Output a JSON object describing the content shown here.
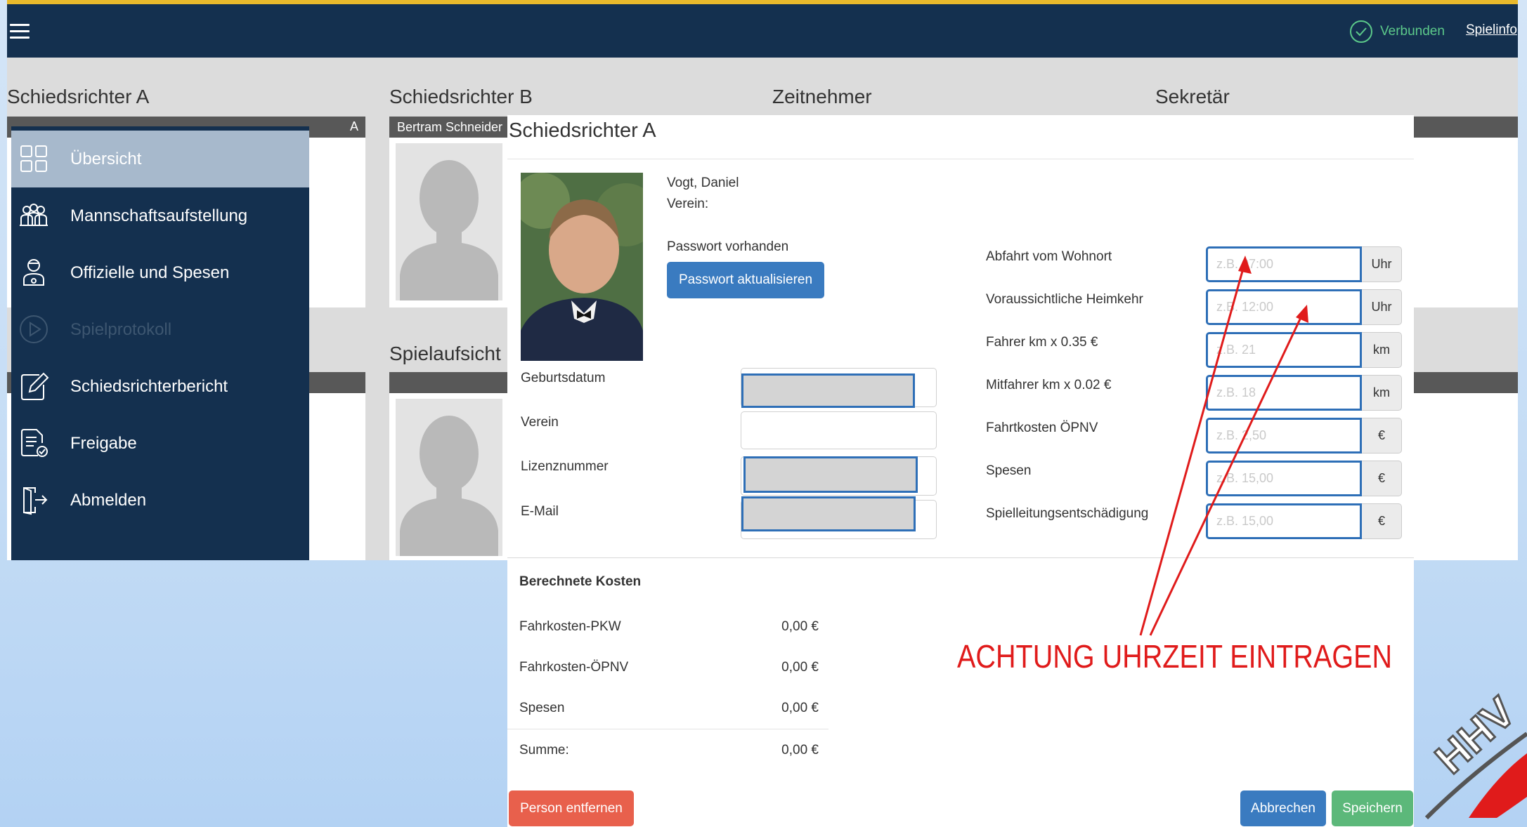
{
  "topbar": {
    "status_label": "Verbunden",
    "status_color": "#5cc98a",
    "spielinfo_link": "Spielinfo",
    "menu_icon": "hamburger-icon",
    "accent_color": "#e8b92c",
    "bar_color": "#14304f"
  },
  "background": {
    "sections": {
      "schiedsrichter_a": "Schiedsrichter A",
      "schiedsrichter_b": "Schiedsrichter B",
      "zeitnehmer": "Zeitnehmer",
      "sekretaer": "Sekretär",
      "spielaufsicht": "Spielaufsicht"
    },
    "card_a_badge": "A",
    "card_b_name": "Bertram Schneider"
  },
  "sidebar": {
    "items": [
      {
        "label": "Übersicht",
        "icon": "grid-icon",
        "state": "active"
      },
      {
        "label": "Mannschaftsaufstellung",
        "icon": "team-icon",
        "state": "normal"
      },
      {
        "label": "Offizielle und Spesen",
        "icon": "official-icon",
        "state": "normal"
      },
      {
        "label": "Spielprotokoll",
        "icon": "play-circle-icon",
        "state": "disabled"
      },
      {
        "label": "Schiedsrichterbericht",
        "icon": "edit-report-icon",
        "state": "normal"
      },
      {
        "label": "Freigabe",
        "icon": "document-check-icon",
        "state": "normal"
      },
      {
        "label": "Abmelden",
        "icon": "logout-icon",
        "state": "normal"
      }
    ]
  },
  "modal": {
    "title": "Schiedsrichter A",
    "person_name": "Vogt, Daniel",
    "verein_label": "Verein:",
    "password_status": "Passwort vorhanden",
    "password_button": "Passwort aktualisieren",
    "fields": {
      "geburtsdatum": "Geburtsdatum",
      "verein": "Verein",
      "lizenznummer": "Lizenznummer",
      "email": "E-Mail"
    },
    "expenses": [
      {
        "label": "Abfahrt vom Wohnort",
        "placeholder": "z.B. 07:00",
        "unit": "Uhr"
      },
      {
        "label": "Voraussichtliche Heimkehr",
        "placeholder": "z.B. 12:00",
        "unit": "Uhr"
      },
      {
        "label": "Fahrer km x 0.35 €",
        "placeholder": "z.B. 21",
        "unit": "km"
      },
      {
        "label": "Mitfahrer km x 0.02 €",
        "placeholder": "z.B. 18",
        "unit": "km"
      },
      {
        "label": "Fahrtkosten ÖPNV",
        "placeholder": "z.B. 2,50",
        "unit": "€"
      },
      {
        "label": "Spesen",
        "placeholder": "z.B. 15,00",
        "unit": "€"
      },
      {
        "label": "Spielleitungsentschädigung",
        "placeholder": "z.B. 15,00",
        "unit": "€"
      }
    ],
    "costs_heading": "Berechnete Kosten",
    "costs": [
      {
        "label": "Fahrkosten-PKW",
        "value": "0,00 €"
      },
      {
        "label": "Fahrkosten-ÖPNV",
        "value": "0,00 €"
      },
      {
        "label": "Spesen",
        "value": "0,00 €"
      }
    ],
    "sum": {
      "label": "Summe:",
      "value": "0,00 €"
    },
    "remove_button": "Person entfernen",
    "cancel_button": "Abbrechen",
    "save_button": "Speichern",
    "remove_color": "#e8604c",
    "cancel_color": "#3a7bc0",
    "save_color": "#5cb87a"
  },
  "annotation": {
    "text": "ACHTUNG UHRZEIT EINTRAGEN",
    "color": "#e01b1b"
  },
  "logo": {
    "text": "HHV"
  }
}
